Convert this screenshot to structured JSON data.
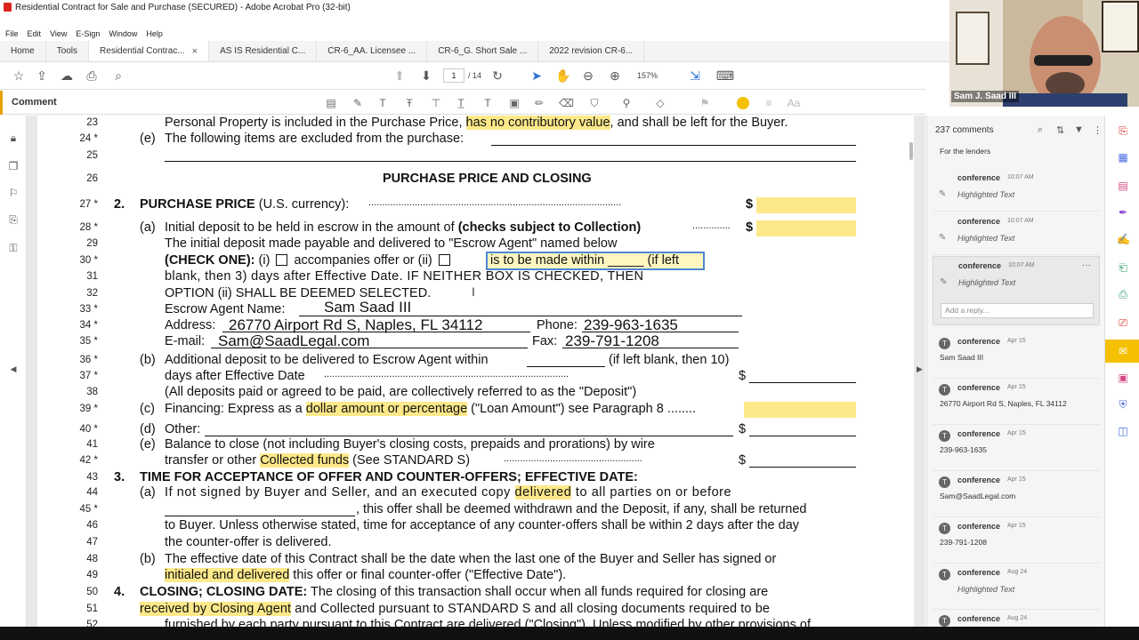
{
  "window": {
    "title": "Residential Contract for Sale and Purchase (SECURED) - Adobe Acrobat Pro (32-bit)"
  },
  "menu": [
    "File",
    "Edit",
    "View",
    "E-Sign",
    "Window",
    "Help"
  ],
  "tabs": [
    {
      "label": "Home"
    },
    {
      "label": "Tools"
    },
    {
      "label": "Residential Contrac...",
      "close": "×"
    },
    {
      "label": "AS IS Residential C..."
    },
    {
      "label": "CR-6_AA. Licensee ..."
    },
    {
      "label": "CR-6_G. Short Sale ..."
    },
    {
      "label": "2022 revision CR-6..."
    }
  ],
  "toolbar": {
    "page": "1",
    "total": "/ 14",
    "zoom": "157%"
  },
  "commentbar": {
    "label": "Comment",
    "color": "#f4c000"
  },
  "doc": {
    "l23": {
      "n": "23",
      "a": "Personal Property is included in the Purchase Price, ",
      "b": "has no contributory value",
      "c": ", and shall be left for the Buyer."
    },
    "l24": {
      "n": "24 *",
      "a": "(e)",
      "b": "The following items are excluded from the purchase:"
    },
    "l25": {
      "n": "25"
    },
    "l26": {
      "n": "26",
      "t": "PURCHASE PRICE AND CLOSING"
    },
    "l27": {
      "n": "27 *",
      "a": "2.",
      "b": "PURCHASE PRICE",
      "c": "(U.S. currency):",
      "d": ".............................................................................................",
      "e": "$"
    },
    "l28": {
      "n": "28 *",
      "a": "(a)",
      "b": "Initial deposit to be held in escrow in the amount of",
      "c": "(checks subject to Collection)",
      "d": "..............",
      "e": "$"
    },
    "l29": {
      "n": "29",
      "t": "The initial deposit made payable and delivered to \"Escrow Agent\" named below"
    },
    "l30": {
      "n": "30 *",
      "a": "(CHECK ONE):",
      "b": "(i)",
      "c": "accompanies offer or (ii)",
      "sel": "is to be made within _____ (if left"
    },
    "l31": {
      "n": "31",
      "t": "blank, then 3) days after Effective Date. IF NEITHER BOX IS CHECKED, THEN"
    },
    "l32": {
      "n": "32",
      "t": "OPTION (ii) SHALL BE DEEMED SELECTED."
    },
    "l33": {
      "n": "33 *",
      "a": "Escrow Agent Name:",
      "b": "Sam Saad III"
    },
    "l34": {
      "n": "34 *",
      "a": "Address:",
      "b": "26770 Airport Rd S, Naples, FL 34112",
      "c": "Phone:",
      "d": "239-963-1635"
    },
    "l35": {
      "n": "35 *",
      "a": "E-mail:",
      "b": "Sam@SaadLegal.com",
      "c": "Fax:",
      "d": "239-791-1208"
    },
    "l36": {
      "n": "36 *",
      "a": "(b)",
      "b": "Additional deposit to be delivered to Escrow Agent within",
      "c": "(if left blank, then 10)"
    },
    "l37": {
      "n": "37 *",
      "a": "days after Effective Date",
      "b": "..........................................................................................",
      "c": "$"
    },
    "l38": {
      "n": "38",
      "t": "(All deposits paid or agreed to be paid, are collectively referred to as the \"Deposit\")"
    },
    "l39": {
      "n": "39 *",
      "a": "(c)",
      "b": "Financing: Express as a ",
      "c": "dollar amount or percentage",
      "d": " (\"Loan Amount\") see Paragraph 8 ........"
    },
    "l40": {
      "n": "40 *",
      "a": "(d)",
      "b": "Other:",
      "c": "$"
    },
    "l41": {
      "n": "41",
      "a": "(e)",
      "b": "Balance to close (not including Buyer's closing costs, prepaids and prorations) by wire"
    },
    "l42": {
      "n": "42 *",
      "a": "transfer or other ",
      "b": "Collected funds",
      "c": " (See STANDARD S)",
      "d": "...................................................",
      "e": "$"
    },
    "l43": {
      "n": "43",
      "a": "3.",
      "b": "TIME FOR ACCEPTANCE OF OFFER AND COUNTER-OFFERS; EFFECTIVE DATE:"
    },
    "l44": {
      "n": "44",
      "a": "(a)",
      "b": "If not signed by Buyer and Seller, and an executed copy ",
      "c": "delivered",
      "d": " to all parties on or before"
    },
    "l45": {
      "n": "45 *",
      "t": ", this offer shall be deemed withdrawn and the Deposit, if any, shall be returned"
    },
    "l46": {
      "n": "46",
      "t": "to Buyer. Unless otherwise stated, time for acceptance of any counter-offers shall be within 2 days after the day"
    },
    "l47": {
      "n": "47",
      "t": "the counter-offer is delivered."
    },
    "l48": {
      "n": "48",
      "a": "(b)",
      "b": "The effective date of this Contract shall be the date when the last one of the Buyer and Seller has signed or"
    },
    "l49": {
      "n": "49",
      "a": "initialed and delivered",
      "b": " this offer or final counter-offer (\"Effective Date\")."
    },
    "l50": {
      "n": "50",
      "a": "4.",
      "b": "CLOSING; CLOSING DATE:",
      "c": " The closing of this transaction shall occur when all funds required for closing are"
    },
    "l51": {
      "n": "51",
      "a": "received by Closing Agent",
      "b": " and Collected pursuant to STANDARD S and all closing documents required to be"
    },
    "l52": {
      "n": "52",
      "t": "furnished by each party pursuant to this Contract are delivered (\"Closing\"). Unless modified by other provisions of"
    }
  },
  "comments": {
    "count": "237 comments",
    "top": "For the lenders",
    "items": [
      {
        "who": "conference",
        "when": "10:07 AM",
        "sub": "Highlighted Text"
      },
      {
        "who": "conference",
        "when": "10:07 AM",
        "sub": "Highlighted Text"
      },
      {
        "who": "conference",
        "when": "10:07 AM",
        "sub": "Highlighted Text",
        "reply": "Add a reply...",
        "more": "···"
      },
      {
        "av": "T",
        "who": "conference",
        "when": "Apr 15",
        "body": "Sam Saad III"
      },
      {
        "av": "T",
        "who": "conference",
        "when": "Apr 15",
        "body": "26770 Airport Rd S, Naples, FL 34112"
      },
      {
        "av": "T",
        "who": "conference",
        "when": "Apr 15",
        "body": "239-963-1635"
      },
      {
        "av": "T",
        "who": "conference",
        "when": "Apr 15",
        "body": "Sam@SaadLegal.com"
      },
      {
        "av": "T",
        "who": "conference",
        "when": "Apr 15",
        "body": "239-791-1208"
      },
      {
        "av": "T",
        "who": "conference",
        "when": "Aug 24",
        "sub": "Highlighted Text"
      },
      {
        "av": "T",
        "who": "conference",
        "when": "Aug 24"
      }
    ]
  },
  "webcam": {
    "name": "Sam J. Saad III"
  }
}
